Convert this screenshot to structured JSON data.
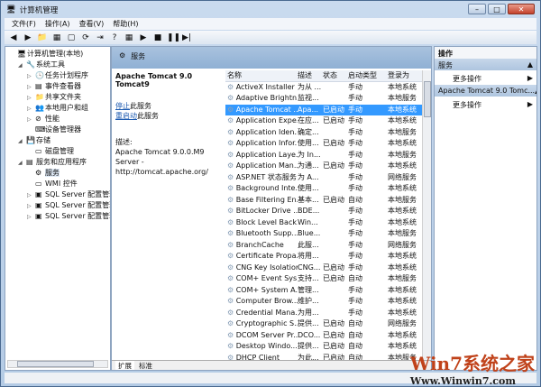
{
  "window": {
    "title": "计算机管理",
    "min": "–",
    "max": "□",
    "close": "✕"
  },
  "menu": [
    "文件(F)",
    "操作(A)",
    "查看(V)",
    "帮助(H)"
  ],
  "toolbar": [
    "◀",
    "▶",
    "📁",
    "▦",
    "▢",
    "⟳",
    "⇥",
    "?",
    "▦",
    "▶",
    "■",
    "❚❚",
    "▶|"
  ],
  "tree": [
    {
      "label": "计算机管理(本地)",
      "indent": 0,
      "icon": "🖥"
    },
    {
      "label": "系统工具",
      "indent": 1,
      "icon": "🔧",
      "exp": "◢"
    },
    {
      "label": "任务计划程序",
      "indent": 2,
      "icon": "🕓",
      "exp": "▷"
    },
    {
      "label": "事件查看器",
      "indent": 2,
      "icon": "▤",
      "exp": "▷"
    },
    {
      "label": "共享文件夹",
      "indent": 2,
      "icon": "📁",
      "exp": "▷"
    },
    {
      "label": "本地用户和组",
      "indent": 2,
      "icon": "👥",
      "exp": "▷"
    },
    {
      "label": "性能",
      "indent": 2,
      "icon": "⊘",
      "exp": "▷"
    },
    {
      "label": "设备管理器",
      "indent": 2,
      "icon": "⌨"
    },
    {
      "label": "存储",
      "indent": 1,
      "icon": "💾",
      "exp": "◢"
    },
    {
      "label": "磁盘管理",
      "indent": 2,
      "icon": "▭"
    },
    {
      "label": "服务和应用程序",
      "indent": 1,
      "icon": "▤",
      "exp": "◢"
    },
    {
      "label": "服务",
      "indent": 2,
      "icon": "⚙"
    },
    {
      "label": "WMI 控件",
      "indent": 2,
      "icon": "▭"
    },
    {
      "label": "SQL Server 配置管理器",
      "indent": 2,
      "icon": "▣",
      "exp": "▷"
    },
    {
      "label": "SQL Server 配置管理器",
      "indent": 2,
      "icon": "▣",
      "exp": "▷"
    },
    {
      "label": "SQL Server 配置管理器",
      "indent": 2,
      "icon": "▣",
      "exp": "▷"
    }
  ],
  "middle": {
    "header": "服务",
    "service_name": "Apache Tomcat 9.0 Tomcat9",
    "stop_link": "停止",
    "stop_suffix": "此服务",
    "restart_link": "重启动",
    "restart_suffix": "此服务",
    "desc_label": "描述:",
    "desc_text": "Apache Tomcat 9.0.0.M9 Server - http://tomcat.apache.org/",
    "columns": [
      "名称",
      "描述",
      "状态",
      "启动类型",
      "登录为"
    ],
    "rows": [
      [
        "ActiveX Installer ...",
        "为从 ...",
        "",
        "手动",
        "本地系统"
      ],
      [
        "Adaptive Brightn...",
        "监视...",
        "",
        "手动",
        "本地服务"
      ],
      [
        "Apache Tomcat ...",
        "Apa...",
        "已启动",
        "手动",
        "本地系统"
      ],
      [
        "Application Expe...",
        "在应...",
        "已启动",
        "手动",
        "本地系统"
      ],
      [
        "Application Iden...",
        "确定...",
        "",
        "手动",
        "本地服务"
      ],
      [
        "Application Infor...",
        "使用...",
        "已启动",
        "手动",
        "本地系统"
      ],
      [
        "Application Laye...",
        "为 In...",
        "",
        "手动",
        "本地服务"
      ],
      [
        "Application Man...",
        "为通...",
        "已启动",
        "手动",
        "本地系统"
      ],
      [
        "ASP.NET 状态服务",
        "为 A...",
        "",
        "手动",
        "网络服务"
      ],
      [
        "Background Inte...",
        "使用...",
        "",
        "手动",
        "本地系统"
      ],
      [
        "Base Filtering En...",
        "基本...",
        "已启动",
        "自动",
        "本地服务"
      ],
      [
        "BitLocker Drive ...",
        "BDE...",
        "",
        "手动",
        "本地系统"
      ],
      [
        "Block Level Back...",
        "Win...",
        "",
        "手动",
        "本地系统"
      ],
      [
        "Bluetooth Supp...",
        "Blue...",
        "",
        "手动",
        "本地服务"
      ],
      [
        "BranchCache",
        "此服...",
        "",
        "手动",
        "网络服务"
      ],
      [
        "Certificate Propa...",
        "将用...",
        "",
        "手动",
        "本地系统"
      ],
      [
        "CNG Key Isolation",
        "CNG...",
        "已启动",
        "手动",
        "本地系统"
      ],
      [
        "COM+ Event Sys...",
        "支持...",
        "已启动",
        "自动",
        "本地服务"
      ],
      [
        "COM+ System A...",
        "管理...",
        "",
        "手动",
        "本地系统"
      ],
      [
        "Computer Brow...",
        "维护...",
        "",
        "手动",
        "本地系统"
      ],
      [
        "Credential Mana...",
        "为用...",
        "",
        "手动",
        "本地系统"
      ],
      [
        "Cryptographic S...",
        "提供...",
        "已启动",
        "自动",
        "网络服务"
      ],
      [
        "DCOM Server Pr...",
        "DCO...",
        "已启动",
        "自动",
        "本地系统"
      ],
      [
        "Desktop Windo...",
        "提供...",
        "已启动",
        "自动",
        "本地系统"
      ],
      [
        "DHCP Client",
        "为此...",
        "已启动",
        "自动",
        "本地服务"
      ]
    ],
    "selected_row": 2,
    "tabs": [
      "扩展",
      "标准"
    ]
  },
  "actions": {
    "title": "操作",
    "sections": [
      {
        "label": "服务",
        "item": "更多操作"
      },
      {
        "label": "Apache Tomcat 9.0 Tomc...",
        "item": "更多操作"
      }
    ]
  },
  "watermark": {
    "brand": "Win7系统之家",
    "url": "Www.Winwin7.com"
  }
}
